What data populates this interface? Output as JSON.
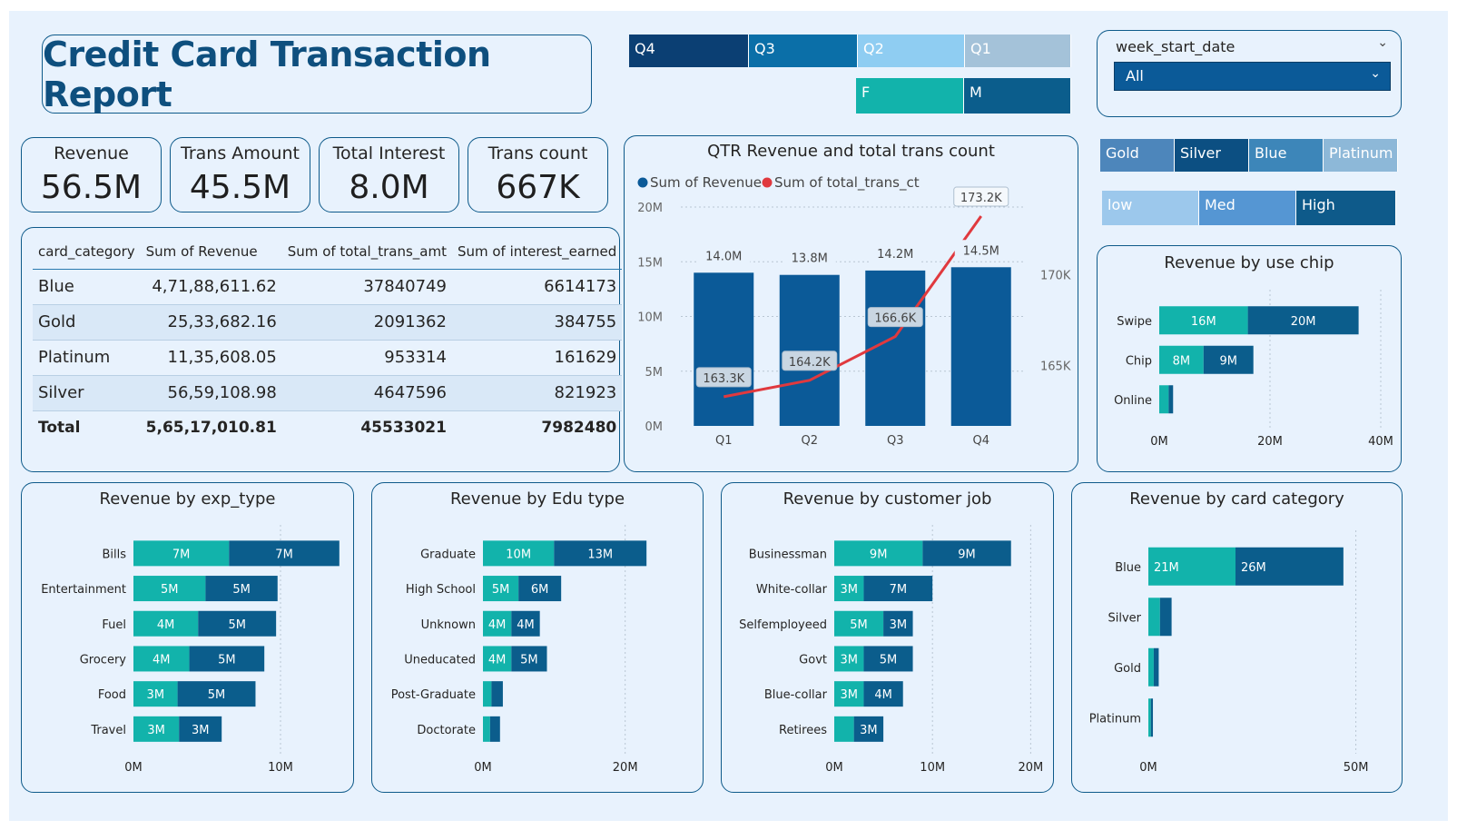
{
  "report": {
    "title": "Credit Card Transaction Report"
  },
  "kpis": [
    {
      "label": "Revenue",
      "value": "56.5M"
    },
    {
      "label": "Trans Amount",
      "value": "45.5M"
    },
    {
      "label": "Total Interest",
      "value": "8.0M"
    },
    {
      "label": "Trans count",
      "value": "667K"
    }
  ],
  "slicers": {
    "quarters": [
      "Q4",
      "Q3",
      "Q2",
      "Q1"
    ],
    "gender": [
      "F",
      "M"
    ],
    "week_start_date": {
      "label": "week_start_date",
      "selected": "All"
    },
    "card_categories": [
      "Gold",
      "Silver",
      "Blue",
      "Platinum"
    ],
    "income_levels": [
      "low",
      "Med",
      "High"
    ]
  },
  "table": {
    "columns": [
      "card_category",
      "Sum of Revenue",
      "Sum of total_trans_amt",
      "Sum of interest_earned"
    ],
    "rows": [
      [
        "Blue",
        "4,71,88,611.62",
        "37840749",
        "6614173"
      ],
      [
        "Gold",
        "25,33,682.16",
        "2091362",
        "384755"
      ],
      [
        "Platinum",
        "11,35,608.05",
        "953314",
        "161629"
      ],
      [
        "Silver",
        "56,59,108.98",
        "4647596",
        "821923"
      ]
    ],
    "total": [
      "Total",
      "5,65,17,010.81",
      "45533021",
      "7982480"
    ]
  },
  "colors": {
    "teal": "#12b3ab",
    "navy": "#0b5d8c",
    "bar_blue": "#0b5a98",
    "line_red": "#e0393e",
    "border": "#0e5a8a"
  },
  "chart_data": [
    {
      "id": "qtr",
      "type": "bar+line",
      "title": "QTR Revenue and total trans count",
      "legend": [
        "Sum of Revenue",
        "Sum of total_trans_ct"
      ],
      "categories": [
        "Q1",
        "Q2",
        "Q3",
        "Q4"
      ],
      "series": [
        {
          "name": "Sum of Revenue",
          "values": [
            14.0,
            13.8,
            14.2,
            14.5
          ],
          "labels": [
            "14.0M",
            "13.8M",
            "14.2M",
            "14.5M"
          ]
        },
        {
          "name": "Sum of total_trans_ct",
          "values": [
            163.3,
            164.2,
            166.6,
            173.2
          ],
          "labels": [
            "163.3K",
            "164.2K",
            "166.6K",
            "173.2K"
          ]
        }
      ],
      "y_ticks": [
        "0M",
        "5M",
        "10M",
        "15M",
        "20M"
      ],
      "ylim": [
        0,
        20
      ],
      "y2_ticks": [
        "165K",
        "170K"
      ],
      "y2lim": [
        161.7,
        173.7
      ]
    },
    {
      "id": "chip",
      "type": "stacked-bar-horizontal",
      "title": "Revenue by use chip",
      "categories": [
        "Swipe",
        "Chip",
        "Online"
      ],
      "series": [
        {
          "values": [
            16,
            8,
            1.7
          ],
          "labels": [
            "16M",
            "8M",
            ""
          ]
        },
        {
          "values": [
            20,
            9,
            0.8
          ],
          "labels": [
            "20M",
            "9M",
            ""
          ]
        }
      ],
      "x_ticks": [
        "0M",
        "20M",
        "40M"
      ],
      "xlim": [
        0,
        40
      ]
    },
    {
      "id": "exp",
      "type": "stacked-bar-horizontal",
      "title": "Revenue by exp_type",
      "categories": [
        "Bills",
        "Entertainment",
        "Fuel",
        "Grocery",
        "Food",
        "Travel"
      ],
      "series": [
        {
          "values": [
            6.5,
            4.9,
            4.4,
            3.8,
            3.0,
            3.1
          ],
          "labels": [
            "7M",
            "5M",
            "4M",
            "4M",
            "3M",
            "3M"
          ]
        },
        {
          "values": [
            7.5,
            4.9,
            5.3,
            5.1,
            5.3,
            2.9
          ],
          "labels": [
            "7M",
            "5M",
            "5M",
            "5M",
            "5M",
            "3M"
          ]
        }
      ],
      "x_ticks": [
        "0M",
        "10M"
      ],
      "xlim": [
        0,
        15
      ]
    },
    {
      "id": "edu",
      "type": "stacked-bar-horizontal",
      "title": "Revenue by Edu type",
      "categories": [
        "Graduate",
        "High School",
        "Unknown",
        "Uneducated",
        "Post-Graduate",
        "Doctorate"
      ],
      "series": [
        {
          "values": [
            10,
            5,
            4,
            4,
            1.2,
            1.0
          ],
          "labels": [
            "10M",
            "5M",
            "4M",
            "4M",
            "",
            ""
          ]
        },
        {
          "values": [
            13,
            6,
            4,
            5,
            1.6,
            1.4
          ],
          "labels": [
            "13M",
            "6M",
            "4M",
            "5M",
            "",
            ""
          ]
        }
      ],
      "x_ticks": [
        "0M",
        "20M"
      ],
      "xlim": [
        0,
        24
      ]
    },
    {
      "id": "job",
      "type": "stacked-bar-horizontal",
      "title": "Revenue by customer job",
      "categories": [
        "Businessman",
        "White-collar",
        "Selfemployeed",
        "Govt",
        "Blue-collar",
        "Retirees"
      ],
      "series": [
        {
          "values": [
            9,
            3,
            5,
            3,
            3,
            2
          ],
          "labels": [
            "9M",
            "3M",
            "5M",
            "3M",
            "3M",
            ""
          ]
        },
        {
          "values": [
            9,
            7,
            3,
            5,
            4,
            3
          ],
          "labels": [
            "9M",
            "7M",
            "3M",
            "5M",
            "4M",
            "3M"
          ]
        }
      ],
      "x_ticks": [
        "0M",
        "10M",
        "20M"
      ],
      "xlim": [
        0,
        22
      ]
    },
    {
      "id": "cat",
      "type": "stacked-bar-horizontal",
      "title": "Revenue by card category",
      "categories": [
        "Blue",
        "Silver",
        "Gold",
        "Platinum"
      ],
      "series": [
        {
          "values": [
            21,
            2.8,
            1.3,
            0.6
          ],
          "labels": [
            "21M",
            "",
            "",
            ""
          ]
        },
        {
          "values": [
            26,
            2.8,
            1.2,
            0.5
          ],
          "labels": [
            "26M",
            "",
            "",
            ""
          ]
        }
      ],
      "x_ticks": [
        "0M",
        "50M"
      ],
      "xlim": [
        0,
        56
      ]
    }
  ]
}
